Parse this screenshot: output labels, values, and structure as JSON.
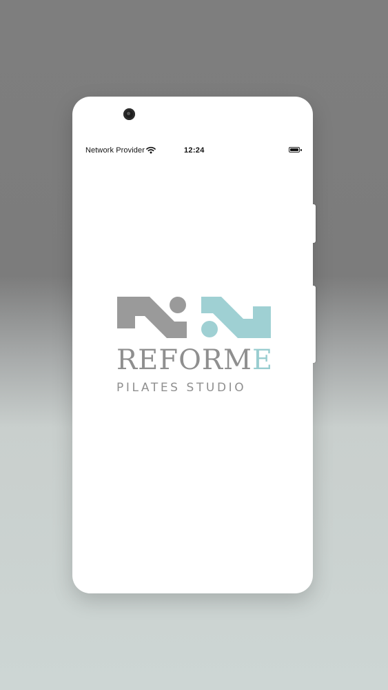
{
  "status_bar": {
    "carrier": "Network Provider",
    "time": "12:24",
    "wifi_icon": "wifi-icon",
    "battery_icon": "battery-icon",
    "battery_level": 1.0
  },
  "splash": {
    "brand_main": "REFORM",
    "brand_accent": "E",
    "tagline": "PILATES STUDIO",
    "colors": {
      "gray": "#8f8f8f",
      "teal": "#99cdd0"
    }
  },
  "device": {
    "camera_icon": "front-camera-icon"
  }
}
